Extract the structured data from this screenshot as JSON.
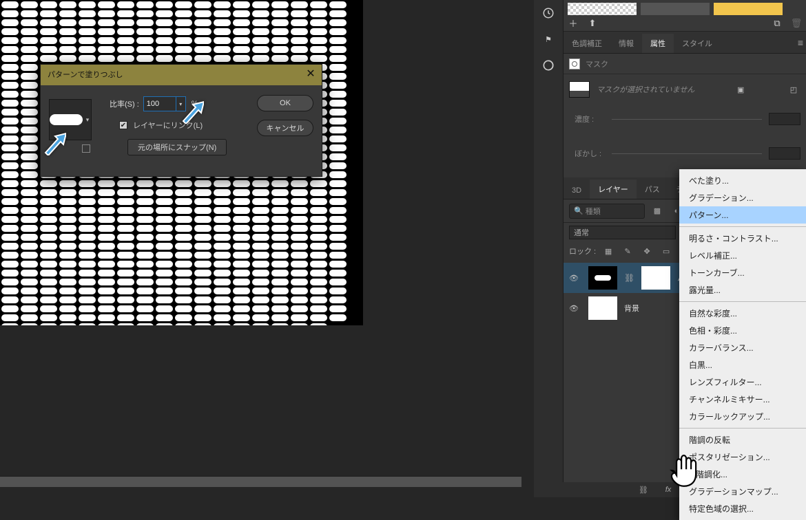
{
  "dialog": {
    "title": "パターンで塗りつぶし",
    "scale_label": "比率(S) :",
    "scale_value": "100",
    "scale_suffix": "%",
    "link_label": "レイヤーにリンク(L)",
    "snap_label": "元の場所にスナップ(N)",
    "ok": "OK",
    "cancel": "キャンセル"
  },
  "right": {
    "prop_tabs": [
      "色調補正",
      "情報",
      "属性",
      "スタイル"
    ],
    "prop_active": 2,
    "mask_title": "マスク",
    "mask_msg": "マスクが選択されていません",
    "density_label": "濃度 :",
    "feather_label": "ぼかし :",
    "layer_tabs": [
      "3D",
      "レイヤー",
      "パス",
      "チャンネ"
    ],
    "layer_active": 1,
    "layer_filter": "種類",
    "blend_mode": "通常",
    "lock_label": "ロック :",
    "layers": [
      {
        "name": "パ",
        "active": true,
        "pattern": true,
        "linked": true
      },
      {
        "name": "背景",
        "active": false,
        "pattern": false,
        "linked": false
      }
    ]
  },
  "ctx": {
    "groups": [
      [
        "べた塗り...",
        "グラデーション...",
        "パターン..."
      ],
      [
        "明るさ・コントラスト...",
        "レベル補正...",
        "トーンカーブ...",
        "露光量..."
      ],
      [
        "自然な彩度...",
        "色相・彩度...",
        "カラーバランス...",
        "白黒...",
        "レンズフィルター...",
        "チャンネルミキサー...",
        "カラールックアップ..."
      ],
      [
        "階調の反転",
        "ポスタリゼーション...",
        "2 階調化...",
        "グラデーションマップ...",
        "特定色域の選択..."
      ]
    ],
    "selected": "パターン..."
  }
}
